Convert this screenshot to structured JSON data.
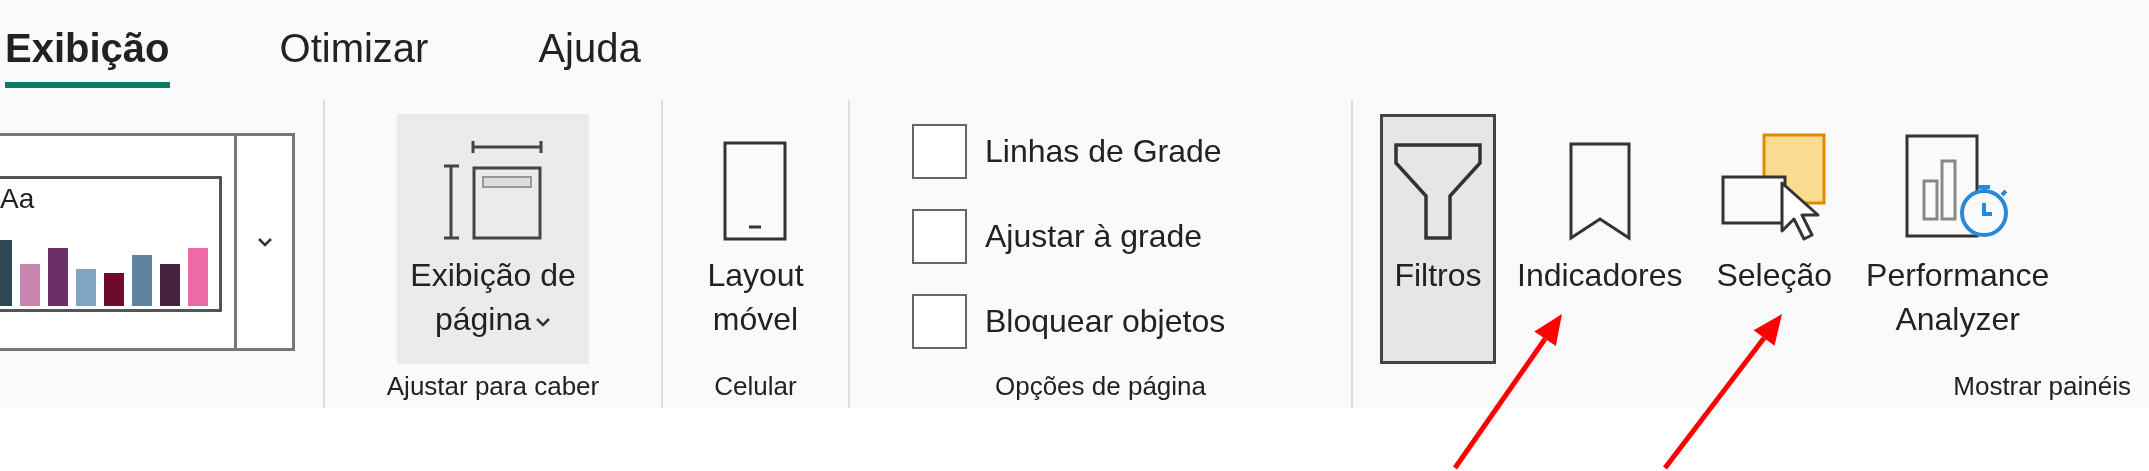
{
  "tabs": [
    {
      "label": "Exibição",
      "selected": true
    },
    {
      "label": "Otimizar",
      "selected": false
    },
    {
      "label": "Ajuda",
      "selected": false
    }
  ],
  "theme_gallery": {
    "preview_text": "Aa"
  },
  "groups": [
    {
      "kind": "buttons",
      "label": "Ajustar para caber",
      "buttons": [
        {
          "kind": "page-view",
          "lines": [
            "Exibição de",
            "página"
          ],
          "dropdown": true,
          "hovered": true,
          "selected": false
        }
      ]
    },
    {
      "kind": "buttons",
      "label": "Celular",
      "buttons": [
        {
          "kind": "phone",
          "lines": [
            "Layout",
            "móvel"
          ],
          "dropdown": false,
          "hovered": false,
          "selected": false
        }
      ]
    },
    {
      "kind": "checkboxes",
      "label": "Opções de página",
      "options": [
        {
          "label": "Linhas de Grade",
          "checked": false
        },
        {
          "label": "Ajustar à grade",
          "checked": false
        },
        {
          "label": "Bloquear objetos",
          "checked": false
        }
      ]
    },
    {
      "kind": "buttons",
      "label": "Mostrar painéis",
      "buttons": [
        {
          "kind": "filter",
          "lines": [
            "Filtros"
          ],
          "selected": true
        },
        {
          "kind": "bookmark",
          "lines": [
            "Indicadores"
          ],
          "selected": false
        },
        {
          "kind": "selection",
          "lines": [
            "Seleção"
          ],
          "selected": false
        },
        {
          "kind": "performance",
          "lines": [
            "Performance",
            "Analyzer"
          ],
          "selected": false
        }
      ]
    }
  ],
  "annotations": [
    {
      "kind": "arrow"
    },
    {
      "kind": "arrow"
    }
  ]
}
